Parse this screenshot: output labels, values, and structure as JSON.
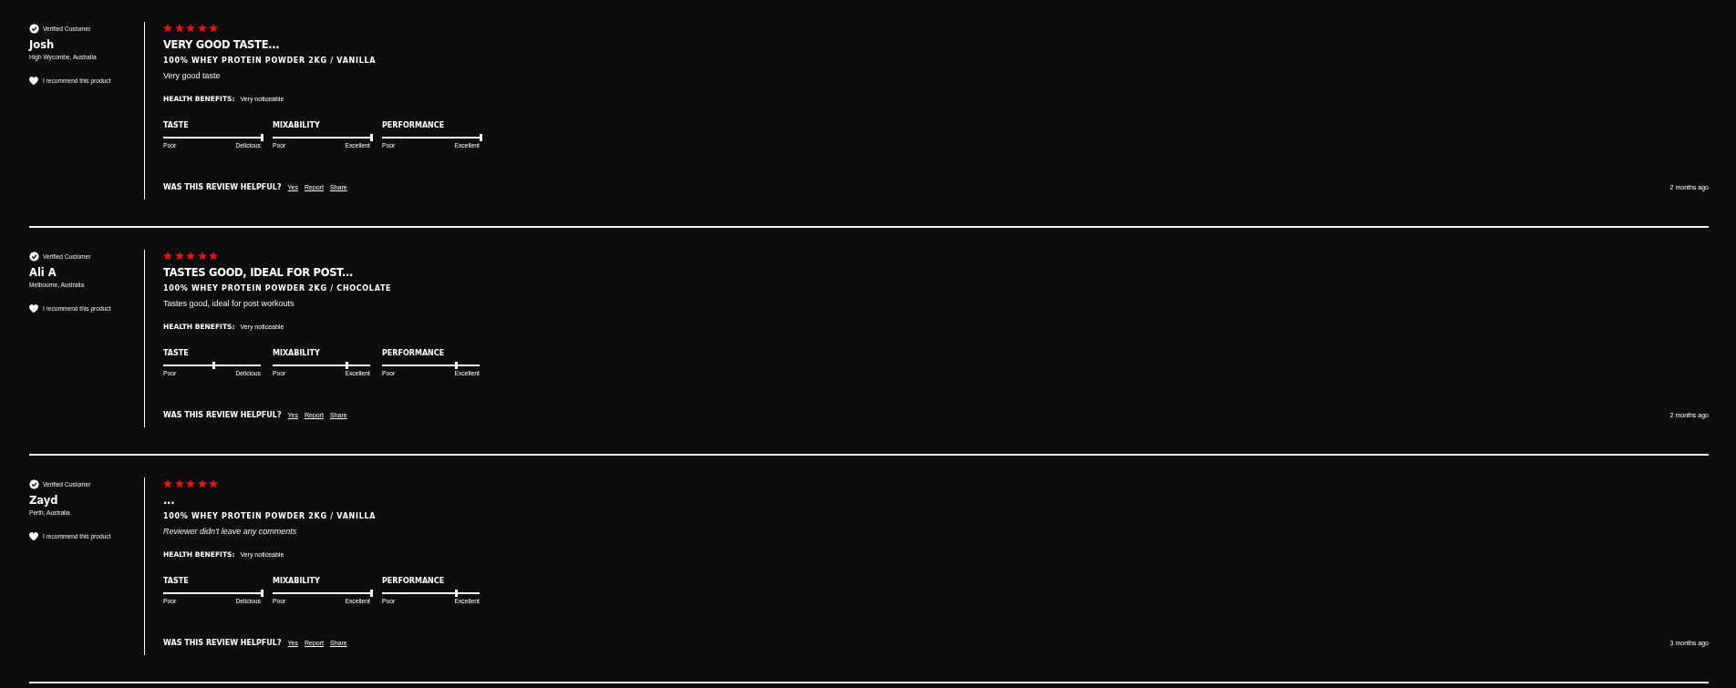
{
  "reviews": [
    {
      "badge": "Verified Customer",
      "name": "Josh",
      "location": "High Wycombe, Australia",
      "recommended": true,
      "recommend_text": "I recommend this product",
      "stars": 5,
      "title": "VERY GOOD TASTE...",
      "product": "100% WHEY PROTEIN POWDER 2KG / VANILLA",
      "comment": "Very good taste",
      "comment_empty": false,
      "health_label": "HEALTH BENEFITS:",
      "health_value": "Very noticeable",
      "ratings": [
        {
          "label": "TASTE",
          "level": 1,
          "min_label": "Poor",
          "max_label": "Delicious"
        },
        {
          "label": "MIXABILITY",
          "level": 1,
          "min_label": "Poor",
          "max_label": "Excellent"
        },
        {
          "label": "PERFORMANCE",
          "level": 1,
          "min_label": "Poor",
          "max_label": "Excellent"
        }
      ],
      "helpful_prompt": "WAS THIS REVIEW HELPFUL?",
      "actions": [
        "Yes",
        "Report",
        "Share"
      ],
      "time": "2 months ago"
    },
    {
      "badge": "Verified Customer",
      "name": "Ali A",
      "location": "Melbourne, Australia",
      "recommended": true,
      "recommend_text": "I recommend this product",
      "stars": 5,
      "title": "TASTES GOOD, IDEAL FOR POST...",
      "product": "100% WHEY PROTEIN POWDER 2KG / CHOCOLATE",
      "comment": "Tastes good, ideal for post workouts",
      "comment_empty": false,
      "health_label": "HEALTH BENEFITS:",
      "health_value": "Very noticeable",
      "ratings": [
        {
          "label": "TASTE",
          "level": 0.5,
          "min_label": "Poor",
          "max_label": "Delicious"
        },
        {
          "label": "MIXABILITY",
          "level": 0.75,
          "min_label": "Poor",
          "max_label": "Excellent"
        },
        {
          "label": "PERFORMANCE",
          "level": 0.75,
          "min_label": "Poor",
          "max_label": "Excellent"
        }
      ],
      "helpful_prompt": "WAS THIS REVIEW HELPFUL?",
      "actions": [
        "Yes",
        "Report",
        "Share"
      ],
      "time": "2 months ago"
    },
    {
      "badge": "Verified Customer",
      "name": "Zayd",
      "location": "Perth, Australia",
      "recommended": true,
      "recommend_text": "I recommend this product",
      "stars": 5,
      "title": "...",
      "product": "100% WHEY PROTEIN POWDER 2KG / VANILLA",
      "comment": "Reviewer didn't leave any comments",
      "comment_empty": true,
      "health_label": "HEALTH BENEFITS:",
      "health_value": "Very noticeable",
      "ratings": [
        {
          "label": "TASTE",
          "level": 1,
          "min_label": "Poor",
          "max_label": "Delicious"
        },
        {
          "label": "MIXABILITY",
          "level": 1,
          "min_label": "Poor",
          "max_label": "Excellent"
        },
        {
          "label": "PERFORMANCE",
          "level": 0.75,
          "min_label": "Poor",
          "max_label": "Excellent"
        }
      ],
      "helpful_prompt": "WAS THIS REVIEW HELPFUL?",
      "actions": [
        "Yes",
        "Report",
        "Share"
      ],
      "time": "3 months ago"
    }
  ]
}
